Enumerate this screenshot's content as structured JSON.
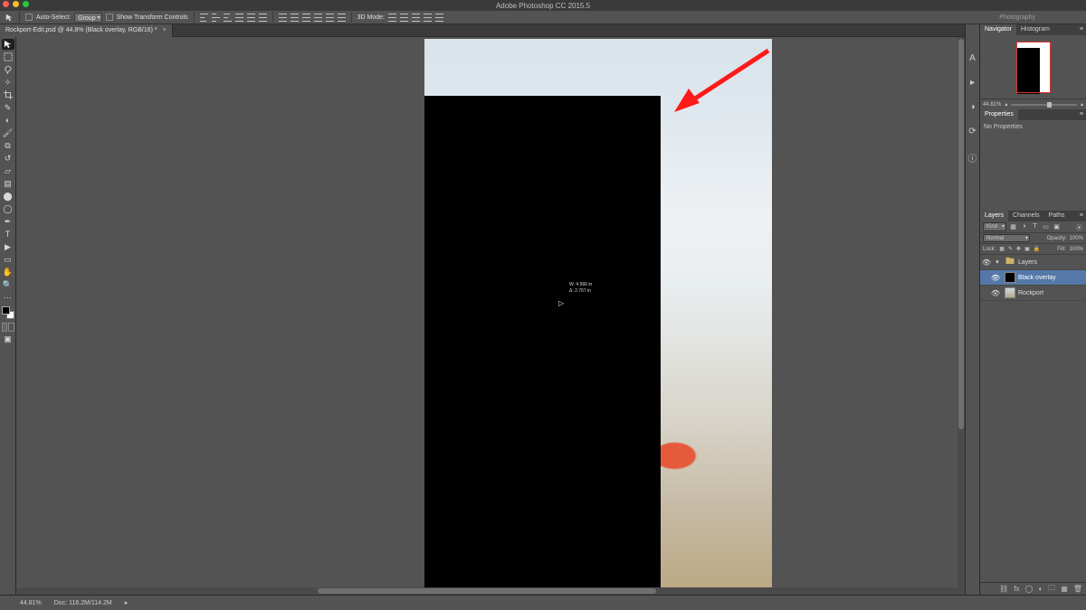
{
  "title_bar": {
    "app_title": "Adobe Photoshop CC 2015.5"
  },
  "options_bar": {
    "auto_select_label": "Auto-Select:",
    "auto_select_mode": "Group",
    "show_tfc_label": "Show Transform Controls",
    "mode_label": "3D Mode:",
    "workspace": "Photography"
  },
  "document_tab": {
    "title": "Rockport-Edit.psd @ 44.8% (Black overlay, RGB/16) *"
  },
  "navigator": {
    "tab_navigator": "Navigator",
    "tab_histogram": "Histogram",
    "zoom_pct": "44.81%"
  },
  "properties": {
    "tab": "Properties",
    "body": "No Properties"
  },
  "layers_panel": {
    "tabs": {
      "layers": "Layers",
      "channels": "Channels",
      "paths": "Paths"
    },
    "filter_kind": "Kind",
    "blend_mode": "Normal",
    "opacity_label": "Opacity:",
    "opacity_value": "100%",
    "lock_label": "Lock:",
    "fill_label": "Fill:",
    "fill_value": "100%",
    "layers": [
      {
        "name": "Layers",
        "type": "group"
      },
      {
        "name": "Black overlay",
        "type": "pixel",
        "selected": true
      },
      {
        "name": "Rockport",
        "type": "smart"
      }
    ]
  },
  "smart_guides": {
    "w_label": "W:",
    "w_value": "4.566 in",
    "h_label": "Δ:",
    "h_value": "2.767 in"
  },
  "status_bar": {
    "zoom": "44.81%",
    "doc_info": "Doc: 116.2M/114.2M"
  }
}
